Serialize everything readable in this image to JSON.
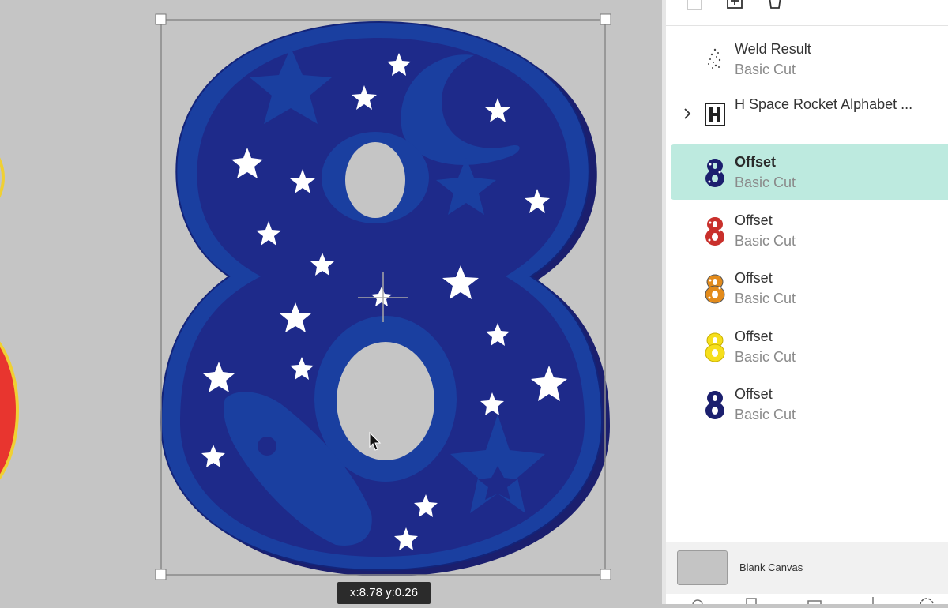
{
  "canvas": {
    "background": "#c5c5c5",
    "coordinate_readout": "x:8.78 y:0.26"
  },
  "toolbar": {
    "icons": [
      "ungroup-icon",
      "duplicate-icon",
      "delete-icon"
    ]
  },
  "layers": [
    {
      "name": "Weld Result",
      "operation": "Basic Cut",
      "thumb": "scatter-icon",
      "selected": false,
      "expandable": false
    },
    {
      "name": "H Space Rocket Alphabet ...",
      "operation": "",
      "thumb": "group-icon",
      "selected": false,
      "expandable": true
    },
    {
      "name": "Offset",
      "operation": "Basic Cut",
      "thumb": "digit-8-navy-stars",
      "selected": true,
      "expandable": false,
      "color": "#1b1f6e"
    },
    {
      "name": "Offset",
      "operation": "Basic Cut",
      "thumb": "digit-8-red-stars",
      "selected": false,
      "expandable": false,
      "color": "#d33"
    },
    {
      "name": "Offset",
      "operation": "Basic Cut",
      "thumb": "digit-8-orange-stars",
      "selected": false,
      "expandable": false,
      "color": "#e38b1b"
    },
    {
      "name": "Offset",
      "operation": "Basic Cut",
      "thumb": "digit-8-yellow",
      "selected": false,
      "expandable": false,
      "color": "#f6df1c"
    },
    {
      "name": "Offset",
      "operation": "Basic Cut",
      "thumb": "digit-8-navy",
      "selected": false,
      "expandable": false,
      "color": "#1b1f6e"
    }
  ],
  "blank_canvas": {
    "label": "Blank Canvas"
  },
  "colors": {
    "selection_highlight": "#bdeadf",
    "digit_dark": "#1b1f6e",
    "digit_outer": "#1a3fa0",
    "digit_inner": "#1e2a8a",
    "star": "#ffffff"
  }
}
